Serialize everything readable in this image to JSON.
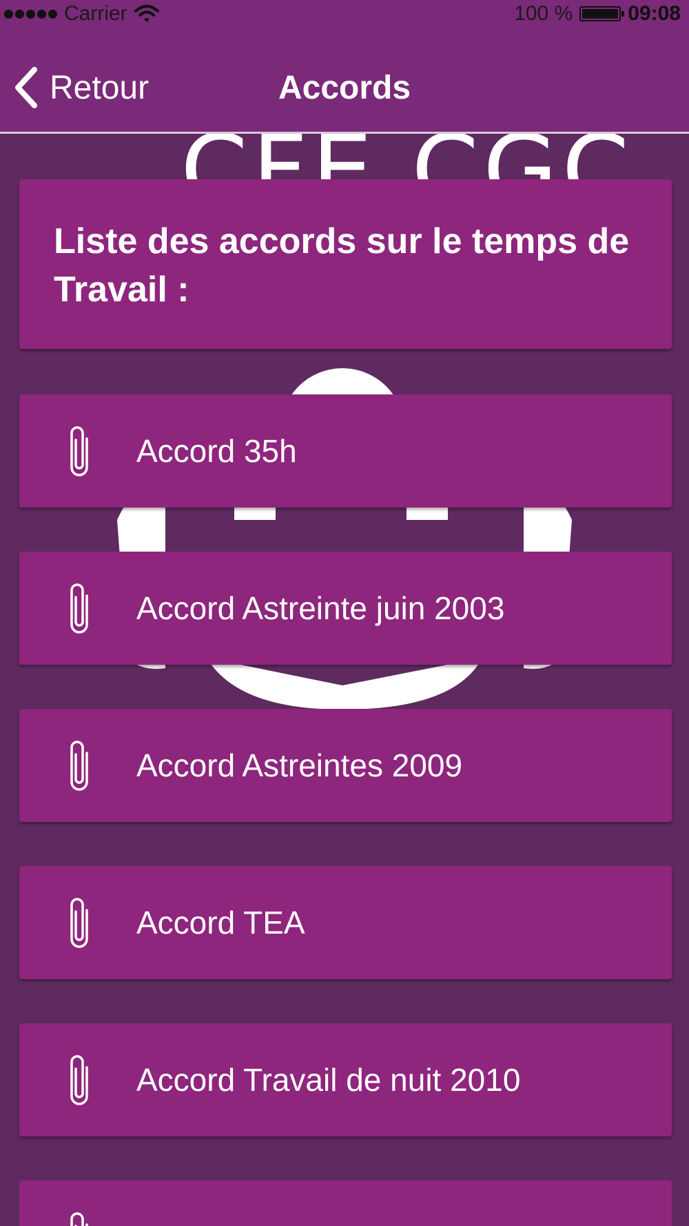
{
  "status_bar": {
    "carrier": "Carrier",
    "battery": "100 %",
    "time": "09:08"
  },
  "nav": {
    "back_label": "Retour",
    "title": "Accords"
  },
  "background": {
    "logo_text": "CFE CGC"
  },
  "header": {
    "title": "Liste des accords sur le temps de Travail :"
  },
  "items": [
    {
      "label": "Accord 35h",
      "icon": "paperclip-icon"
    },
    {
      "label": "Accord Astreinte juin 2003",
      "icon": "paperclip-icon"
    },
    {
      "label": "Accord Astreintes 2009",
      "icon": "paperclip-icon"
    },
    {
      "label": "Accord TEA",
      "icon": "paperclip-icon"
    },
    {
      "label": "Accord Travail de nuit 2010",
      "icon": "paperclip-icon"
    },
    {
      "label": "",
      "icon": "paperclip-icon"
    }
  ],
  "colors": {
    "background": "#5f2a60",
    "bar": "#7a2a78",
    "card": "#8e267d",
    "text": "#ffffff"
  }
}
